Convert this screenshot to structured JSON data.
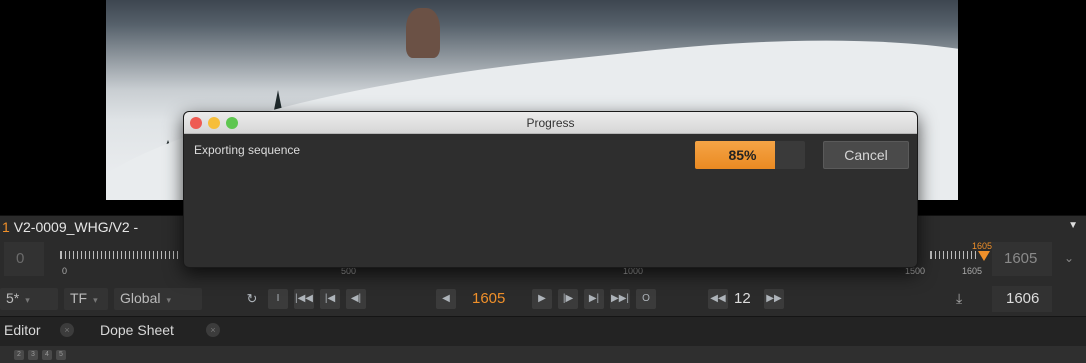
{
  "dialog": {
    "title": "Progress",
    "message": "Exporting sequence",
    "progress_percent": 85,
    "progress_label": "85%",
    "cancel_label": "Cancel",
    "traffic_lights": [
      "#ee5b53",
      "#f6be3b",
      "#5ec650"
    ]
  },
  "timeline": {
    "clip_index": "1",
    "clip_name": "V2-0009_WHG/V2 -",
    "in_frame": "0",
    "out_frame_display": "1605",
    "ruler_labels": [
      "0",
      "500",
      "1000",
      "1500",
      "1605"
    ],
    "playhead_label": "1605"
  },
  "transport": {
    "fps_value": "5*",
    "tf_label": "TF",
    "scope_label": "Global",
    "current_frame": "1605",
    "step_value": "12",
    "end_frame": "1606",
    "buttons": [
      "I",
      "|◀◀",
      "|◀",
      "◀|",
      "◀",
      "▶",
      "|▶",
      "▶|",
      "▶▶|",
      "O",
      "◀◀",
      "▶▶"
    ]
  },
  "tabs": [
    {
      "label": "Editor"
    },
    {
      "label": "Dope Sheet"
    }
  ],
  "mini_buttons": [
    "2",
    "3",
    "4",
    "5"
  ],
  "colors": {
    "accent": "#f0902a",
    "panel": "#2b2b2b"
  }
}
